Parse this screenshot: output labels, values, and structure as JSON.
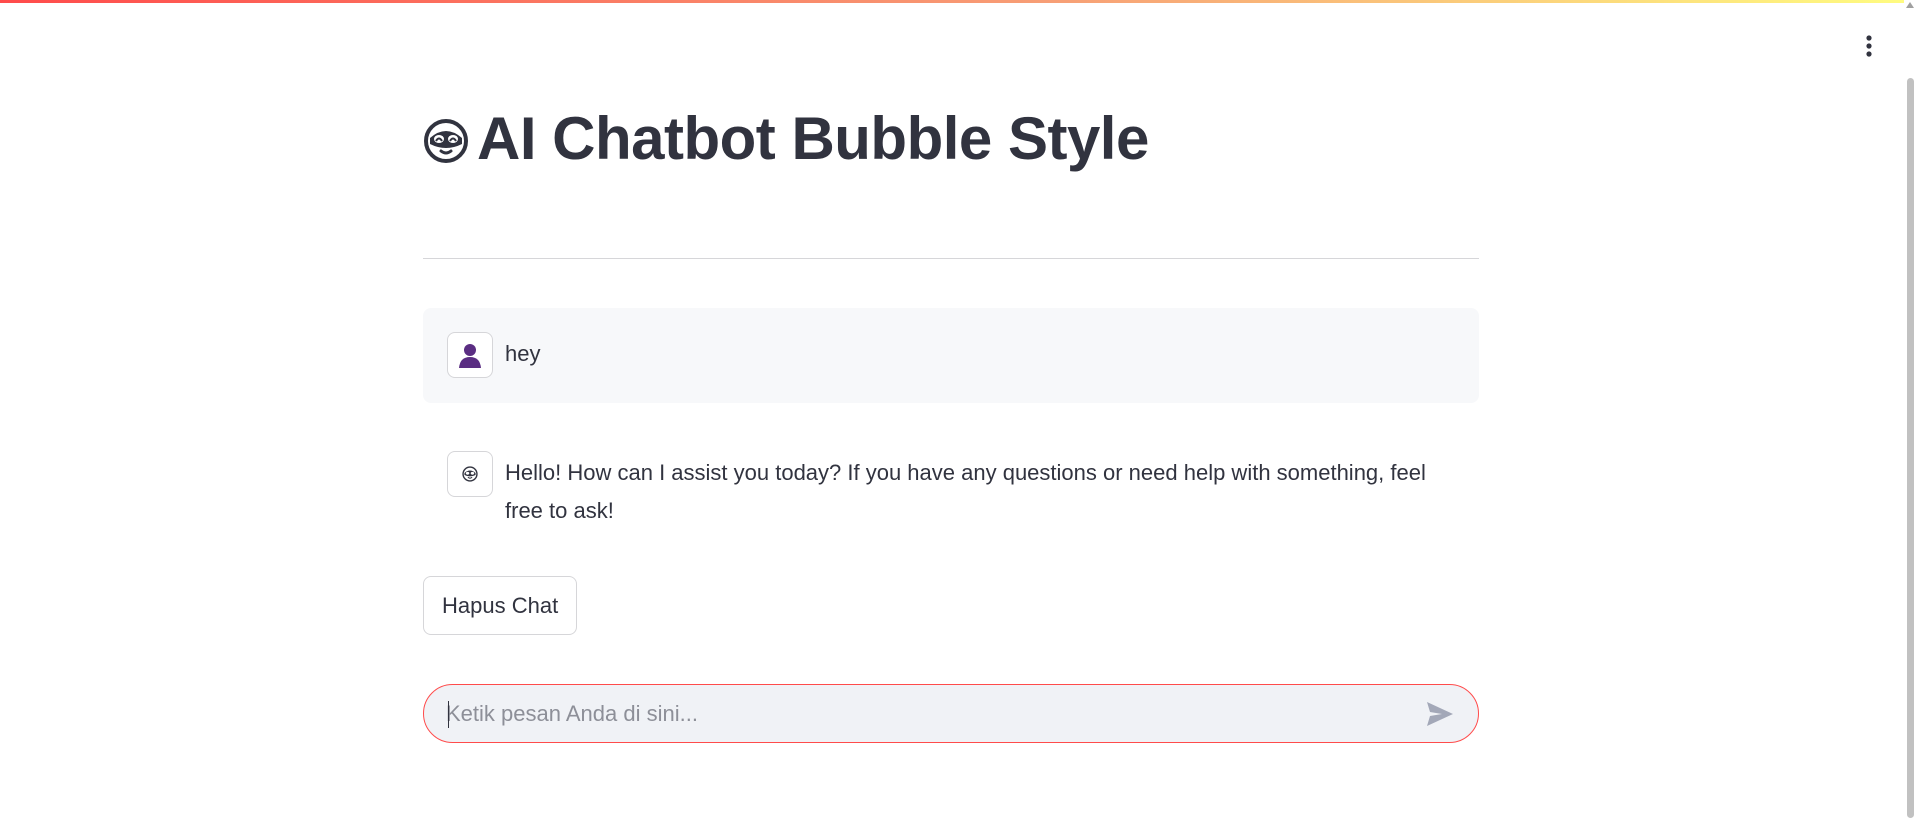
{
  "app": {
    "title": "AI Chatbot Bubble Style",
    "title_icon": "robot-face-icon",
    "accent_color": "#ff4b4b"
  },
  "header": {
    "menu_icon": "kebab-menu-icon"
  },
  "messages": [
    {
      "role": "user",
      "avatar_icon": "user-silhouette-icon",
      "text": "hey"
    },
    {
      "role": "assistant",
      "avatar_icon": "robot-face-icon",
      "text": "Hello! How can I assist you today? If you have any questions or need help with something, feel free to ask!"
    }
  ],
  "actions": {
    "clear_label": "Hapus Chat"
  },
  "chat_input": {
    "placeholder": "Ketik pesan Anda di sini...",
    "value": "",
    "send_icon": "send-arrow-icon"
  }
}
